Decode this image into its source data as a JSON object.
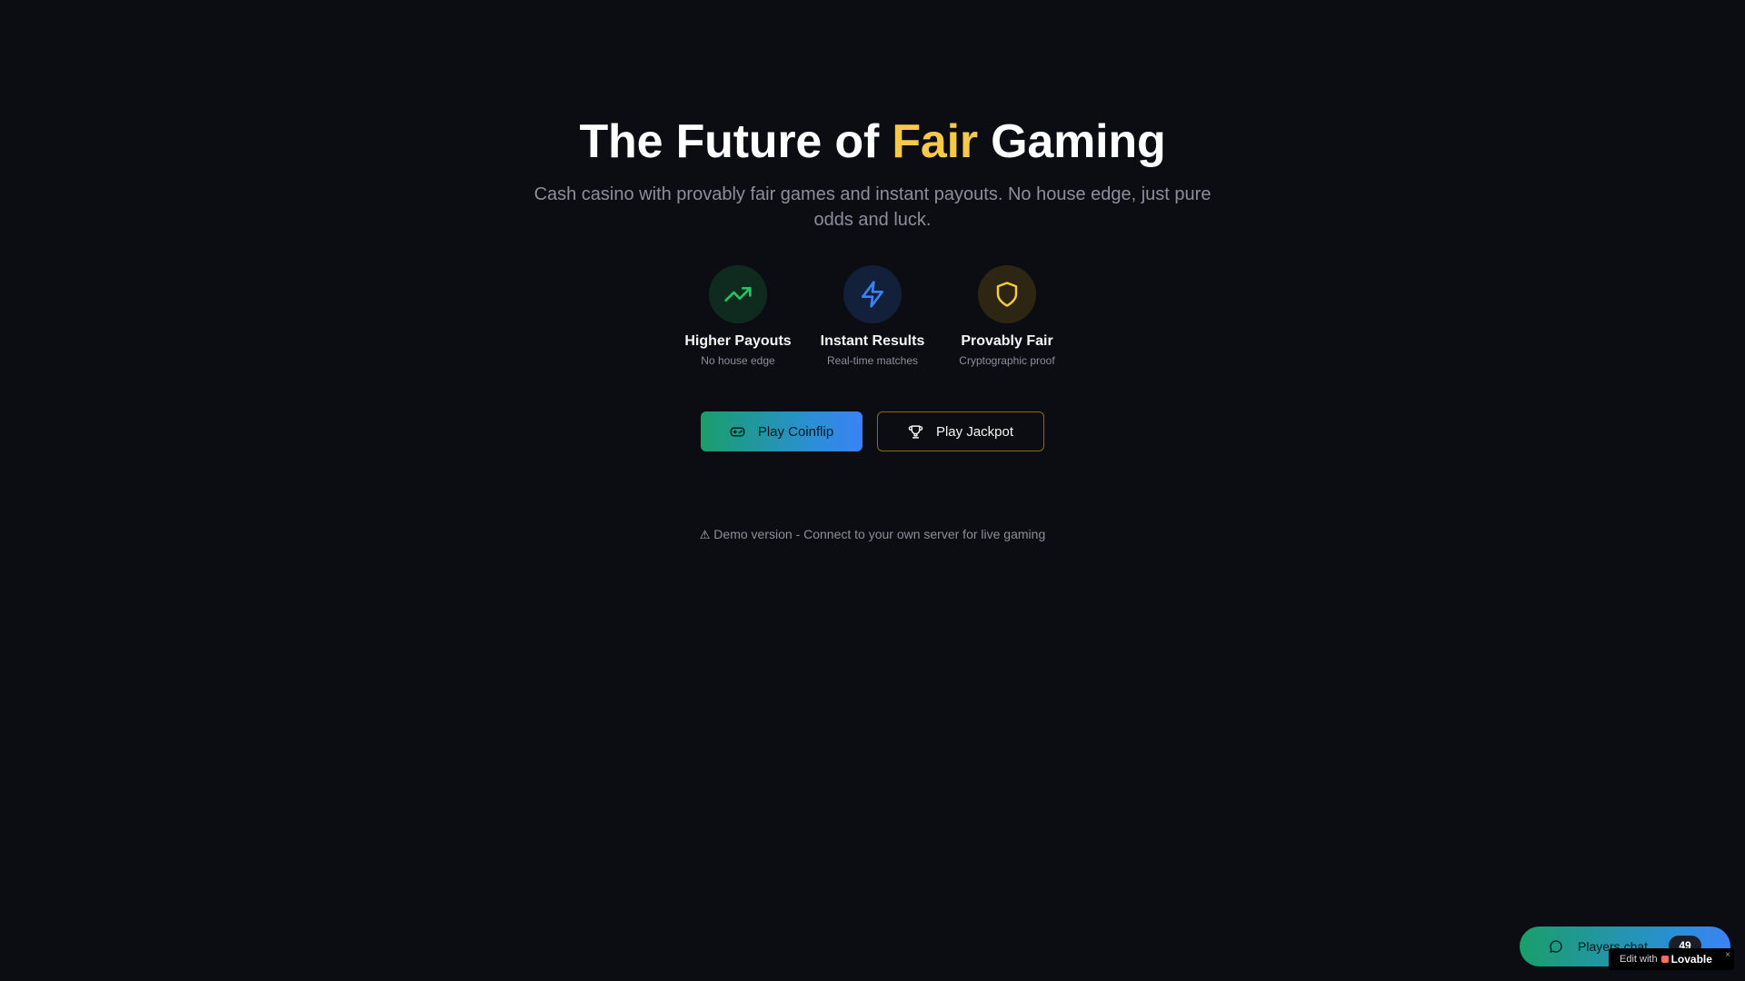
{
  "hero": {
    "title_before": "The Future of ",
    "title_accent": "Fair",
    "title_after": " Gaming",
    "subtitle": "Cash casino with provably fair games and instant payouts. No house edge, just pure odds and luck."
  },
  "features": [
    {
      "title": "Higher Payouts",
      "subtitle": "No house edge",
      "icon": "trending-up-icon",
      "color": "#22c55e",
      "bg": "#0f2a1e"
    },
    {
      "title": "Instant Results",
      "subtitle": "Real-time matches",
      "icon": "lightning-icon",
      "color": "#3b82f6",
      "bg": "#13203a"
    },
    {
      "title": "Provably Fair",
      "subtitle": "Cryptographic proof",
      "icon": "shield-icon",
      "color": "#f7c948",
      "bg": "#2c2612"
    }
  ],
  "actions": {
    "coinflip_label": "Play Coinflip",
    "jackpot_label": "Play Jackpot"
  },
  "notice": {
    "icon": "⚠",
    "text": "Demo version - Connect to your own server for live gaming"
  },
  "chat": {
    "label": "Players chat",
    "count": "49"
  },
  "lovable": {
    "prefix": "Edit with",
    "brand": "Lovable",
    "close": "×"
  },
  "colors": {
    "background": "#0c0d12",
    "accent_gold": "#f7c948",
    "muted_text": "#8b8f9b"
  }
}
